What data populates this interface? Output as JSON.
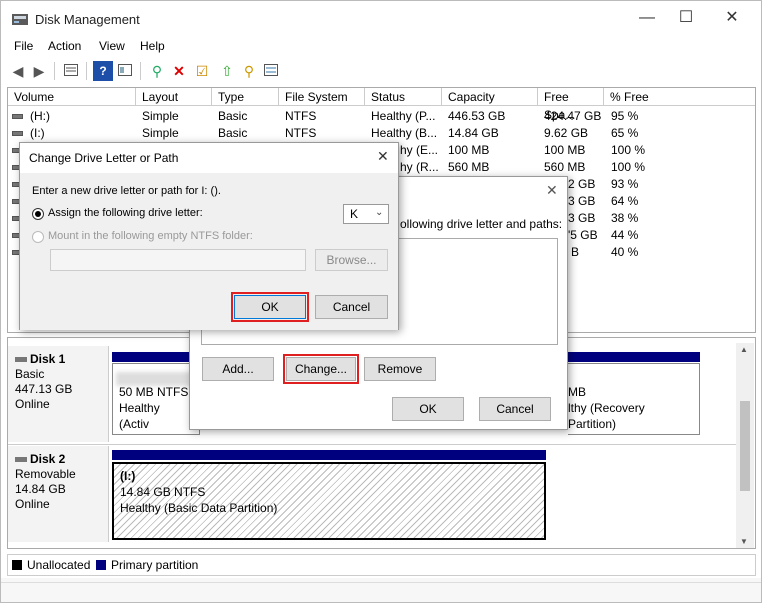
{
  "window": {
    "title": "Disk Management",
    "min": "—",
    "max": "☐",
    "close": "✕"
  },
  "menu": [
    "File",
    "Action",
    "View",
    "Help"
  ],
  "columns": [
    "Volume",
    "Layout",
    "Type",
    "File System",
    "Status",
    "Capacity",
    "Free Spa...",
    "% Free"
  ],
  "volumes": [
    {
      "volume": "(H:)",
      "layout": "Simple",
      "type": "Basic",
      "fs": "NTFS",
      "status": "Healthy (P...",
      "capacity": "446.53 GB",
      "free": "424.47 GB",
      "pct": "95 %"
    },
    {
      "volume": "(I:)",
      "layout": "Simple",
      "type": "Basic",
      "fs": "NTFS",
      "status": "Healthy (B...",
      "capacity": "14.84 GB",
      "free": "9.62 GB",
      "pct": "65 %"
    },
    {
      "status": "hy (E...",
      "capacity": "100 MB",
      "free": "100 MB",
      "pct": "100 %"
    },
    {
      "status": "hy (R...",
      "capacity": "560 MB",
      "free": "560 MB",
      "pct": "100 %"
    },
    {
      "free": "2 GB",
      "pct": "93 %"
    },
    {
      "free": "3 GB",
      "pct": "64 %"
    },
    {
      "free": "3 GB",
      "pct": "38 %"
    },
    {
      "free": "'5 GB",
      "pct": "44 %"
    },
    {
      "free": "B",
      "pct": "40 %"
    }
  ],
  "disk1": {
    "name": "Disk 1",
    "type": "Basic",
    "size": "447.13 GB",
    "state": "Online",
    "p1": {
      "size": "50 MB NTFS",
      "status": "Healthy (Activ"
    },
    "p2": {
      "size": "MB",
      "status": "lthy (Recovery Partition)"
    }
  },
  "disk2": {
    "name": "Disk 2",
    "type": "Removable",
    "size": "14.84 GB",
    "state": "Online",
    "p1": {
      "label": "(I:)",
      "size": "14.84 GB NTFS",
      "status": "Healthy (Basic Data Partition)"
    }
  },
  "legend": {
    "unallocated": "Unallocated",
    "primary": "Primary partition"
  },
  "dlg_paths": {
    "text": "ollowing drive letter and paths:",
    "add": "Add...",
    "change": "Change...",
    "remove": "Remove",
    "ok": "OK",
    "cancel": "Cancel",
    "close": "✕"
  },
  "dlg_change": {
    "title": "Change Drive Letter or Path",
    "close": "✕",
    "prompt": "Enter a new drive letter or path for I: ().",
    "assign": "Assign the following drive letter:",
    "letter": "K",
    "mount": "Mount in the following empty NTFS folder:",
    "browse": "Browse...",
    "ok": "OK",
    "cancel": "Cancel"
  },
  "colors": {
    "primary": "#00007f",
    "highlight": "#e02020"
  }
}
